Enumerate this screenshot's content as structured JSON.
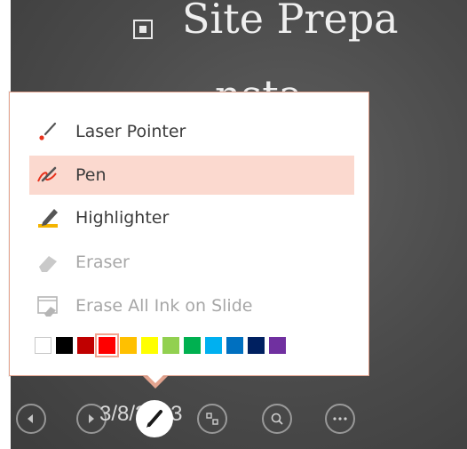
{
  "slide": {
    "title": "Site Prepa",
    "line2": "nsta",
    "date": "3/8/2013"
  },
  "menu": {
    "items": [
      {
        "label": "Laser Pointer",
        "icon": "laser-pointer-icon",
        "state": "normal"
      },
      {
        "label": "Pen",
        "icon": "pen-icon",
        "state": "selected"
      },
      {
        "label": "Highlighter",
        "icon": "highlighter-icon",
        "state": "normal"
      },
      {
        "label": "Eraser",
        "icon": "eraser-icon",
        "state": "disabled"
      },
      {
        "label": "Erase All Ink on Slide",
        "icon": "erase-all-icon",
        "state": "disabled"
      }
    ],
    "colors": [
      "#ffffff",
      "#000000",
      "#c00000",
      "#ff0000",
      "#ffc000",
      "#ffff00",
      "#92d050",
      "#00b050",
      "#00b0f0",
      "#0070c0",
      "#002060",
      "#7030a0"
    ],
    "selected_color": "#ff0000",
    "accent": "#fbd9cf"
  },
  "controls": [
    {
      "name": "previous-button",
      "icon": "back-arrow-icon"
    },
    {
      "name": "next-button",
      "icon": "forward-arrow-icon"
    },
    {
      "name": "pen-tools-button",
      "icon": "pen-icon",
      "active": true
    },
    {
      "name": "see-all-slides-button",
      "icon": "slides-icon"
    },
    {
      "name": "zoom-button",
      "icon": "magnifier-icon"
    },
    {
      "name": "more-options-button",
      "icon": "ellipsis-icon"
    }
  ]
}
